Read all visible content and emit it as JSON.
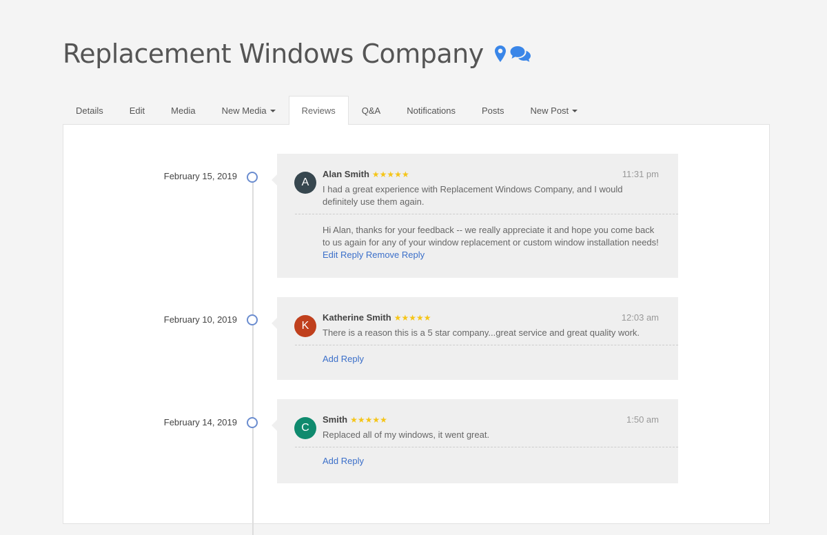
{
  "page": {
    "title": "Replacement Windows Company",
    "icons": [
      "map-marker-icon",
      "comments-icon"
    ],
    "accent_color": "#3a86e8"
  },
  "tabs": [
    {
      "label": "Details"
    },
    {
      "label": "Edit"
    },
    {
      "label": "Media"
    },
    {
      "label": "New Media",
      "dropdown": true
    },
    {
      "label": "Reviews",
      "active": true
    },
    {
      "label": "Q&A"
    },
    {
      "label": "Notifications"
    },
    {
      "label": "Posts"
    },
    {
      "label": "New Post",
      "dropdown": true
    }
  ],
  "reviews": [
    {
      "date": "February 15, 2019",
      "avatar_letter": "A",
      "avatar_color": "#37474f",
      "name": "Alan Smith",
      "stars": "★★★★★",
      "rating": 5,
      "time": "11:31 pm",
      "text": "I had a great experience with Replacement Windows Company, and I would definitely use them again.",
      "reply": "Hi Alan, thanks for your feedback -- we really appreciate it and hope you come back to us again for any of your window replacement or custom window installation needs!",
      "edit_reply_label": "Edit Reply",
      "remove_reply_label": "Remove Reply"
    },
    {
      "date": "February 10, 2019",
      "avatar_letter": "K",
      "avatar_color": "#c0401d",
      "name": "Katherine Smith",
      "stars": "★★★★★",
      "rating": 5,
      "time": "12:03 am",
      "text": "There is a reason this is a 5 star company...great service and great quality work.",
      "add_reply_label": "Add Reply"
    },
    {
      "date": "February 14, 2019",
      "avatar_letter": "C",
      "avatar_color": "#0f8a6e",
      "name": "Smith",
      "stars": "★★★★★",
      "rating": 5,
      "time": "1:50 am",
      "text": "Replaced all of my windows, it went great.",
      "add_reply_label": "Add Reply"
    }
  ]
}
